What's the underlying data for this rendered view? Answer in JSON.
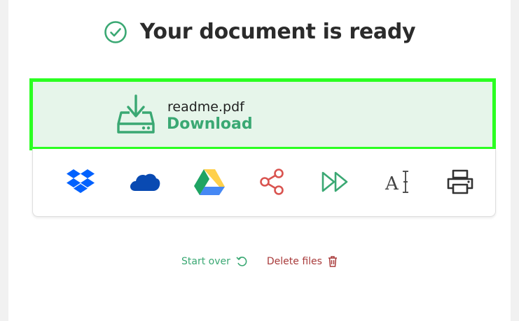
{
  "header": {
    "title": "Your document is ready"
  },
  "download": {
    "filename": "readme.pdf",
    "label": "Download"
  },
  "tools": [
    {
      "name": "dropbox-icon",
      "color": "#0061fe"
    },
    {
      "name": "onedrive-icon",
      "color": "#094ab2"
    },
    {
      "name": "google-drive-icon",
      "colors": [
        "#1fa463",
        "#ffd04b",
        "#4688f4"
      ]
    },
    {
      "name": "share-icon",
      "color": "#d9534f"
    },
    {
      "name": "forward-icon",
      "color": "#3aa873"
    },
    {
      "name": "ocr-text-icon",
      "color": "#444444"
    },
    {
      "name": "printer-icon",
      "color": "#333333"
    }
  ],
  "footer": {
    "start_over": "Start over",
    "delete_files": "Delete files"
  },
  "colors": {
    "accent_green": "#3aa873",
    "highlight_border": "#2bff21",
    "card_bg": "#e6f5ea",
    "danger": "#a83a3a"
  }
}
